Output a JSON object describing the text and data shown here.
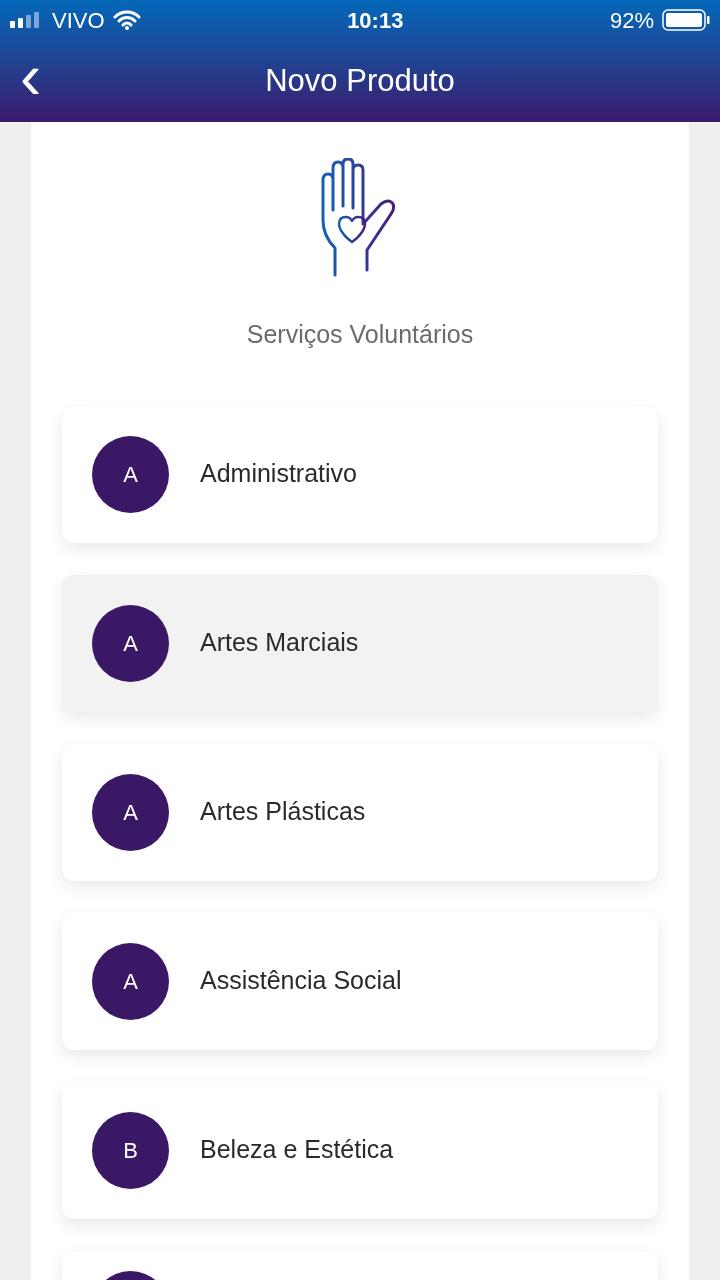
{
  "status_bar": {
    "carrier": "VIVO",
    "time": "10:13",
    "battery": "92%"
  },
  "header": {
    "back": "‹",
    "title": "Novo Produto"
  },
  "category": {
    "title": "Serviços Voluntários"
  },
  "items": [
    {
      "initial": "A",
      "name": "Administrativo",
      "selected": false
    },
    {
      "initial": "A",
      "name": "Artes Marciais",
      "selected": true
    },
    {
      "initial": "A",
      "name": "Artes Plásticas",
      "selected": false
    },
    {
      "initial": "A",
      "name": "Assistência Social",
      "selected": false
    },
    {
      "initial": "B",
      "name": "Beleza e Estética",
      "selected": false
    }
  ]
}
